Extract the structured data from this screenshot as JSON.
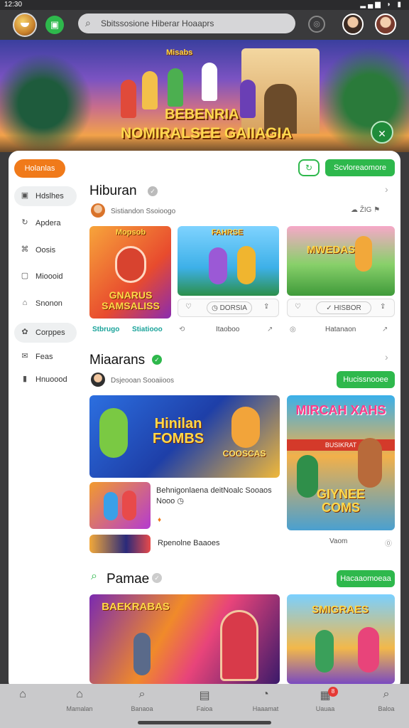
{
  "status": {
    "time": "12:30",
    "icons": "▂▄▆ ◗ ▮"
  },
  "search": {
    "text": "Sbitssosione Hiberar Hoaaprs"
  },
  "hero": {
    "tag": "Misabs",
    "line1": "BEBENRIA",
    "line2": "NOMIRALSEE GAIIAGIA"
  },
  "filters": {
    "orange_pill": "Holanlas",
    "green_button": "Scvloreaomore"
  },
  "sidebar": {
    "items": [
      {
        "label": "Hdslhes",
        "icon": "▣"
      },
      {
        "label": "Apdera",
        "icon": "↻"
      },
      {
        "label": "Oosis",
        "icon": "⌘"
      },
      {
        "label": "Mioooid",
        "icon": "▢"
      },
      {
        "label": "Snonon",
        "icon": "⌂"
      },
      {
        "label": "Corppes",
        "icon": "✿"
      },
      {
        "label": "Feas",
        "icon": "✉"
      },
      {
        "label": "Hnuoood",
        "icon": "▮"
      }
    ]
  },
  "section1": {
    "title": "Hiburan",
    "subtitle": "Sistiandon Ssoioogo",
    "meta": "ŽIG",
    "cards": [
      {
        "title": "GNARUS SAMSALISS",
        "tag": "Mopsob",
        "label_a": "Stbrugo",
        "label_b": "Stiatiooo"
      },
      {
        "title": "FAHRSE",
        "action": "DORSIA",
        "label": "Itaoboo"
      },
      {
        "title": "MWEDAS",
        "action": "HISBOR",
        "label": "Hatanaon"
      }
    ]
  },
  "section2": {
    "title": "Miaarans",
    "subtitle": "Dsjeooan Sooaiioos",
    "button": "Hucissnooee",
    "big_card": {
      "title": "Hinilan FOMBS",
      "badge": "COOSCAS"
    },
    "list_item": {
      "title": "Behnigonlaena deitNoalc Sooaos",
      "sub": "Nooo"
    },
    "list_item2": "Rpenolne Baaoes",
    "tall_card": {
      "top": "MIRCAH XAHS",
      "bottom": "GIYNEE COMS",
      "band": "BUSIKRAT",
      "label": "Vaom"
    }
  },
  "section3": {
    "title": "Pamae",
    "button": "Hacaaomoeaa",
    "card1": {
      "title": "BAEKRABAS"
    },
    "card2": {
      "title": "SMIGRAES"
    }
  },
  "nav": [
    {
      "label": "",
      "icon": "⌂"
    },
    {
      "label": "Mamalan",
      "icon": "⌂"
    },
    {
      "label": "Banaoa",
      "icon": "⌕"
    },
    {
      "label": "Faioa",
      "icon": "▤"
    },
    {
      "label": "Haaamat",
      "icon": "◔"
    },
    {
      "label": "Uauaa",
      "icon": "▦"
    },
    {
      "label": "Baloa",
      "icon": "⌕"
    }
  ],
  "nav_badge": "8"
}
